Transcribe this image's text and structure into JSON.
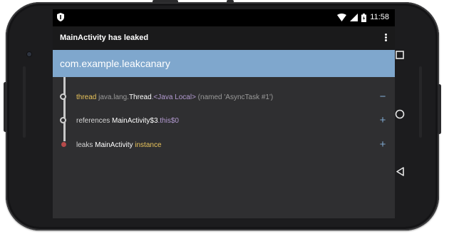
{
  "status_bar": {
    "time": "11:58",
    "left_icon": "shield-icon",
    "icons": [
      "wifi-icon",
      "signal-icon",
      "battery-charging-icon"
    ]
  },
  "action_bar": {
    "title": "MainActivity has leaked",
    "menu_icon": "overflow-menu-icon"
  },
  "header": {
    "title": "com.example.leakcanary"
  },
  "trace": [
    {
      "parts": [
        {
          "text": "thread",
          "color": "yellow"
        },
        {
          "text": " java.lang.",
          "color": "gray"
        },
        {
          "text": "Thread",
          "color": "white"
        },
        {
          "text": ".<Java Local>",
          "color": "purple"
        },
        {
          "text": " (named 'AsyncTask #1')",
          "color": "gray"
        }
      ],
      "action": "−"
    },
    {
      "parts": [
        {
          "text": "references ",
          "color": "light"
        },
        {
          "text": "MainActivity$3",
          "color": "white"
        },
        {
          "text": ".this$0",
          "color": "purple"
        }
      ],
      "action": "+"
    },
    {
      "parts": [
        {
          "text": "leaks ",
          "color": "light"
        },
        {
          "text": "MainActivity",
          "color": "white"
        },
        {
          "text": " instance",
          "color": "yellow"
        }
      ],
      "action": "+"
    }
  ],
  "nav_buttons": [
    "recents-icon",
    "home-icon",
    "back-icon"
  ],
  "colors": {
    "header_bg": "#7fa7cd",
    "screen_bg": "#2f2f31",
    "action_bar_bg": "#1a1a1b",
    "leak_node": "#b64a4a",
    "keyword_yellow": "#e8c35b",
    "purple": "#b39ad1"
  }
}
